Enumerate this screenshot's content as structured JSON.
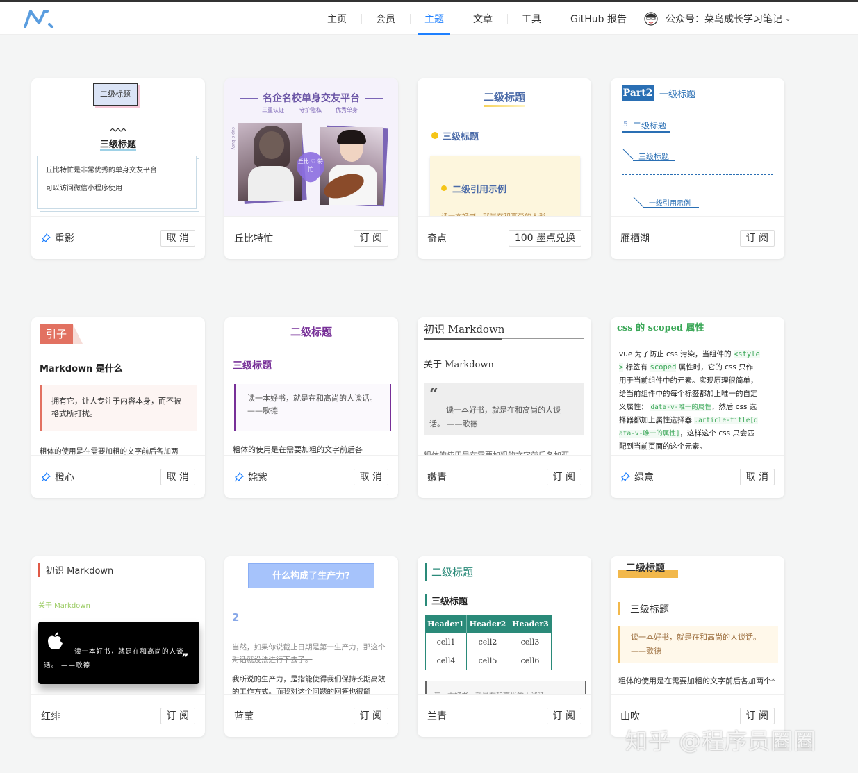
{
  "nav": {
    "items": [
      "主页",
      "会员",
      "主题",
      "文章",
      "工具",
      "GitHub 报告"
    ],
    "active_index": 2,
    "account_label": "公众号：菜鸟成长学习笔记"
  },
  "cards": [
    {
      "name": "重影",
      "action": "取 消",
      "pinned": true,
      "p": {
        "h2": "二级标题",
        "h3": "三级标题",
        "quote1": "丘比特忙是非常优秀的单身交友平台",
        "quote2": "可以访问微信小程序使用"
      }
    },
    {
      "name": "丘比特忙",
      "action": "订 阅",
      "pinned": false,
      "p": {
        "title": "名企名校单身交友平台",
        "sub1": "三重认证",
        "sub2": "守护隐私",
        "sub3": "优秀单身",
        "heart": "丘比 ♡ 特忙",
        "side": "cupid busy"
      }
    },
    {
      "name": "奇点",
      "action": "100 墨点兑换",
      "pinned": false,
      "p": {
        "h2": "二级标题",
        "h3": "三级标题",
        "quote_title": "二级引用示例",
        "quote_text": "读一本好书，就是在和高尚的人谈"
      }
    },
    {
      "name": "雁栖湖",
      "action": "订 阅",
      "pinned": false,
      "p": {
        "part": "Part2",
        "h1": "一级标题",
        "num": "5",
        "h2": "二级标题",
        "h3": "三级标题",
        "quote": "一级引用示例"
      }
    },
    {
      "name": "橙心",
      "action": "取 消",
      "pinned": true,
      "p": {
        "tag": "引子",
        "h2": "Markdown 是什么",
        "quote": "拥有它，让人专注于内容本身，而不被格式所打扰。",
        "body": "粗体的使用是在需要加粗的文字前后各加两"
      }
    },
    {
      "name": "姹紫",
      "action": "取 消",
      "pinned": true,
      "p": {
        "h2": "二级标题",
        "h3": "三级标题",
        "quote": "读一本好书，就是在和高尚的人谈话。 ——歌德",
        "body": "粗体的使用是在需要加粗的文字前后各"
      }
    },
    {
      "name": "嫩青",
      "action": "订 阅",
      "pinned": false,
      "p": {
        "h1": "初识 Markdown",
        "h2": "关于 Markdown",
        "quote": "读一本好书，就是在和高尚的人谈话。 ——歌德",
        "body": "粗体的使用是在需要加粗的文字前后各加两"
      }
    },
    {
      "name": "绿意",
      "action": "取 消",
      "pinned": true,
      "p": {
        "h2": "css 的 scoped 属性",
        "l1a": "vue 为了防止 css 污染，当组件的 ",
        "l1b": "<style",
        "l2a": ">",
        "l2b": " 标签有 ",
        "l2c": "scoped",
        "l2d": " 属性时，它的 css 只作",
        "l3": "用于当前组件中的元素。实现原理很简单，",
        "l4": "给当前组件中的每个标签都加上唯一的自定",
        "l5a": "义属性： ",
        "l5b": "data-v-唯一的属性",
        "l5c": "，然后 css 选",
        "l6a": "择器都加上属性选择器 ",
        "l6b": ".article-title[d",
        "l7a": "ata-v-唯一的属性]",
        "l7b": "，这样这个 css 只会匹",
        "l8": "配到当前页面的这个元素。"
      }
    },
    {
      "name": "红绯",
      "action": "订 阅",
      "pinned": false,
      "p": {
        "h1": "初识 Markdown",
        "h2": "关于 Markdown",
        "quote": "读一本好书，就是在和高尚的人谈话。 ——歌德"
      }
    },
    {
      "name": "蓝莹",
      "action": "订 阅",
      "pinned": false,
      "p": {
        "h1": "什么构成了生产力?",
        "num": "2",
        "del": "当然，如果你说截止日期是第一生产力，那这个对话就没法进行下去了。",
        "body": "我所说的生产力，是指能使得我们保持长期高效的工作方式。而我对这个问题的回答也很简"
      }
    },
    {
      "name": "兰青",
      "action": "订 阅",
      "pinned": false,
      "p": {
        "h2": "二级标题",
        "h3": "三级标题",
        "headers": [
          "Header1",
          "Header2",
          "Header3"
        ],
        "rows": [
          [
            "cell1",
            "cell2",
            "cell3"
          ],
          [
            "cell4",
            "cell5",
            "cell6"
          ]
        ],
        "quote": "读一本好书，就是在和高尚的人谈话"
      }
    },
    {
      "name": "山吹",
      "action": "订 阅",
      "pinned": false,
      "p": {
        "h2": "二级标题",
        "h3": "三级标题",
        "quote": "读一本好书，就是在和高尚的人谈话。 ——歌德",
        "body": "粗体的使用是在需要加粗的文字前后各加两个*"
      }
    }
  ],
  "watermark": "知乎 @程序员圈圈",
  "colors": {
    "accent": "#1e80ff",
    "page_bg": "#f4f5f5"
  }
}
